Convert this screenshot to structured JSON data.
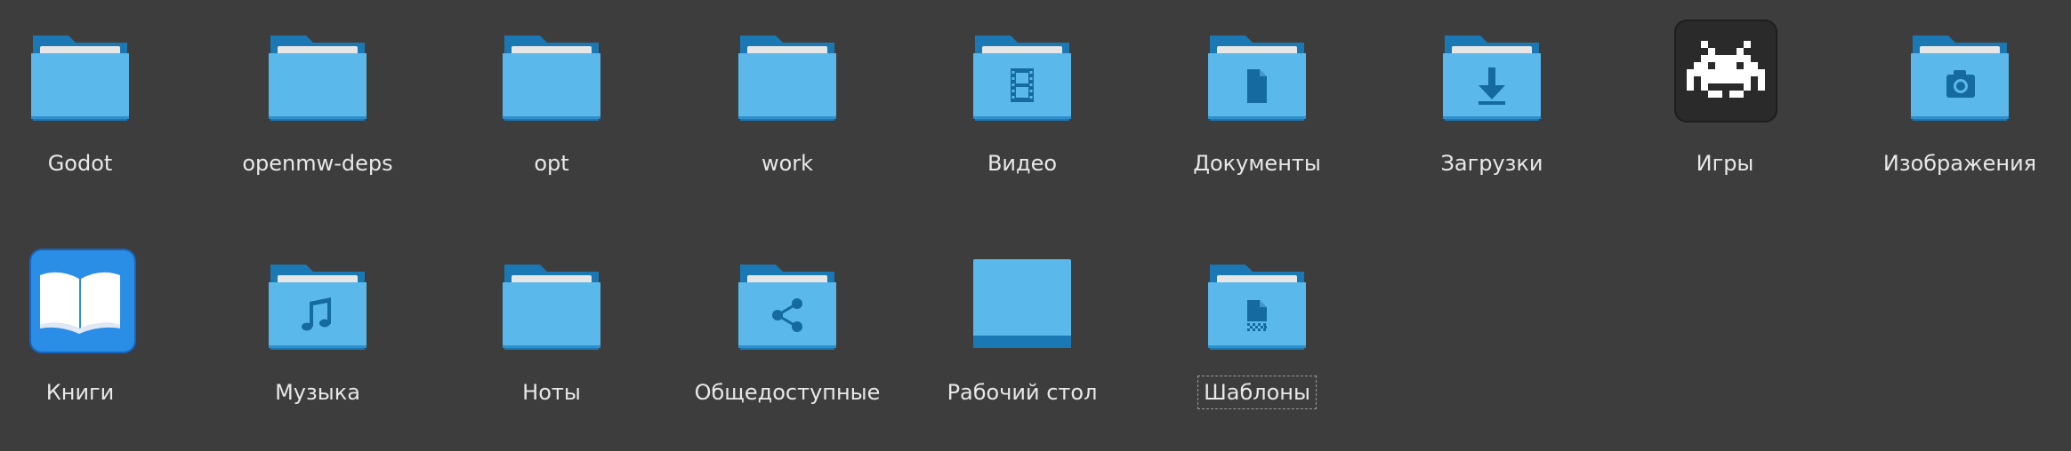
{
  "items": [
    {
      "label": "Godot",
      "icon": "folder-icon"
    },
    {
      "label": "openmw-deps",
      "icon": "folder-icon"
    },
    {
      "label": "opt",
      "icon": "folder-icon"
    },
    {
      "label": "work",
      "icon": "folder-icon"
    },
    {
      "label": "Видео",
      "icon": "folder-videos-icon"
    },
    {
      "label": "Документы",
      "icon": "folder-documents-icon"
    },
    {
      "label": "Загрузки",
      "icon": "folder-downloads-icon"
    },
    {
      "label": "Игры",
      "icon": "games-space-invader-icon"
    },
    {
      "label": "Изображения",
      "icon": "folder-pictures-icon"
    },
    {
      "label": "Книги",
      "icon": "books-icon"
    },
    {
      "label": "Музыка",
      "icon": "folder-music-icon"
    },
    {
      "label": "Ноты",
      "icon": "folder-icon"
    },
    {
      "label": "Общедоступные",
      "icon": "folder-public-share-icon"
    },
    {
      "label": "Рабочий стол",
      "icon": "desktop-folder-icon"
    },
    {
      "label": "Шаблоны",
      "icon": "folder-templates-icon"
    }
  ],
  "colors": {
    "background": "#3d3d3d",
    "folder_light": "#5ab8ea",
    "folder_dark": "#1a78b4",
    "folder_paper": "#e6e6e6",
    "glyph": "#156a9f",
    "text": "#e8e8e8"
  }
}
